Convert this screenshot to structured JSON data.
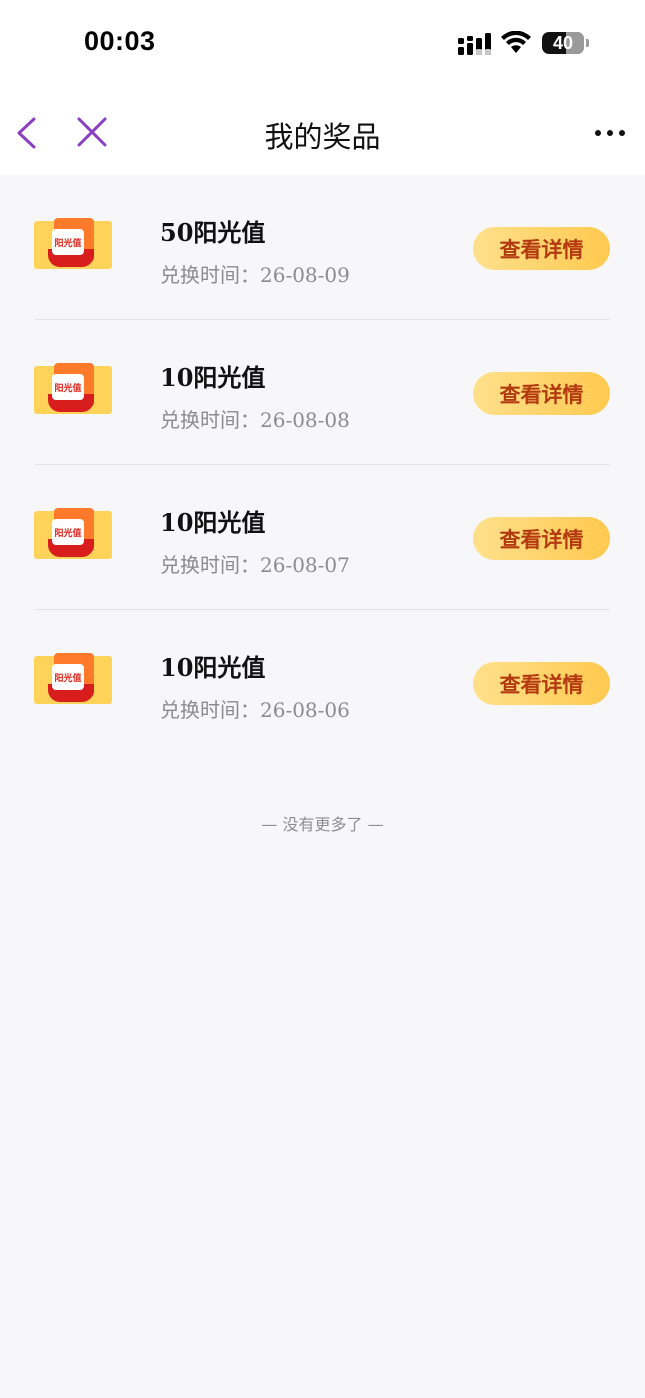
{
  "status_bar": {
    "time": "00:03",
    "battery": "40"
  },
  "nav": {
    "title": "我的奖品"
  },
  "prizes": [
    {
      "thumb_label": "阳光值",
      "name": "50阳光值",
      "date_label": "兑换时间：",
      "date": "26-08-09",
      "button": "查看详情"
    },
    {
      "thumb_label": "阳光值",
      "name": "10阳光值",
      "date_label": "兑换时间：",
      "date": "26-08-08",
      "button": "查看详情"
    },
    {
      "thumb_label": "阳光值",
      "name": "10阳光值",
      "date_label": "兑换时间：",
      "date": "26-08-07",
      "button": "查看详情"
    },
    {
      "thumb_label": "阳光值",
      "name": "10阳光值",
      "date_label": "兑换时间：",
      "date": "26-08-06",
      "button": "查看详情"
    }
  ],
  "footer": {
    "no_more": "— 没有更多了 —"
  },
  "colors": {
    "accent": "#8a3fc2",
    "button_text": "#b33a10",
    "button_bg": "#ffd46a"
  }
}
